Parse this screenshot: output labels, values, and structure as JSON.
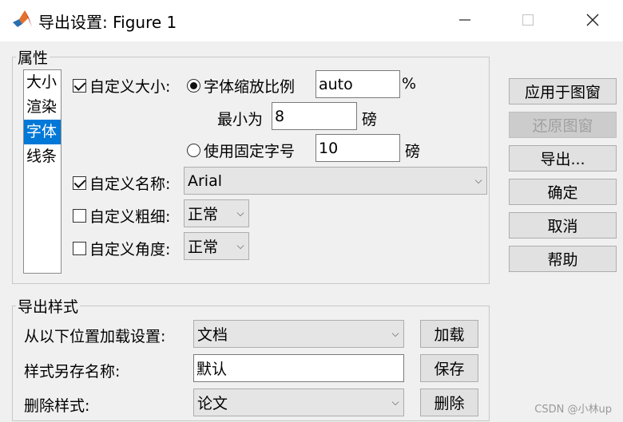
{
  "window": {
    "title": "导出设置: Figure 1"
  },
  "properties": {
    "legend": "属性",
    "list_items": [
      "大小",
      "渲染",
      "字体",
      "线条"
    ],
    "selected_index": 2,
    "custom_size_label": "自定义大小:",
    "font_scale_label": "字体缩放比例",
    "font_scale_value": "auto",
    "percent_symbol": "%",
    "min_label": "最小为",
    "min_value": "8",
    "min_unit": "磅",
    "fixed_font_label": "使用固定字号",
    "fixed_font_value": "10",
    "fixed_font_unit": "磅",
    "custom_name_label": "自定义名称:",
    "custom_name_value": "Arial",
    "custom_weight_label": "自定义粗细:",
    "custom_weight_value": "正常",
    "custom_angle_label": "自定义角度:",
    "custom_angle_value": "正常"
  },
  "side_buttons": {
    "apply": "应用于图窗",
    "restore": "还原图窗",
    "export": "导出...",
    "ok": "确定",
    "cancel": "取消",
    "help": "帮助"
  },
  "export_style": {
    "legend": "导出样式",
    "load_label": "从以下位置加载设置:",
    "load_value": "文档",
    "load_button": "加载",
    "save_label": "样式另存名称:",
    "save_value": "默认",
    "save_button": "保存",
    "delete_label": "删除样式:",
    "delete_value": "论文",
    "delete_button": "删除"
  },
  "watermark": "CSDN @小林up"
}
